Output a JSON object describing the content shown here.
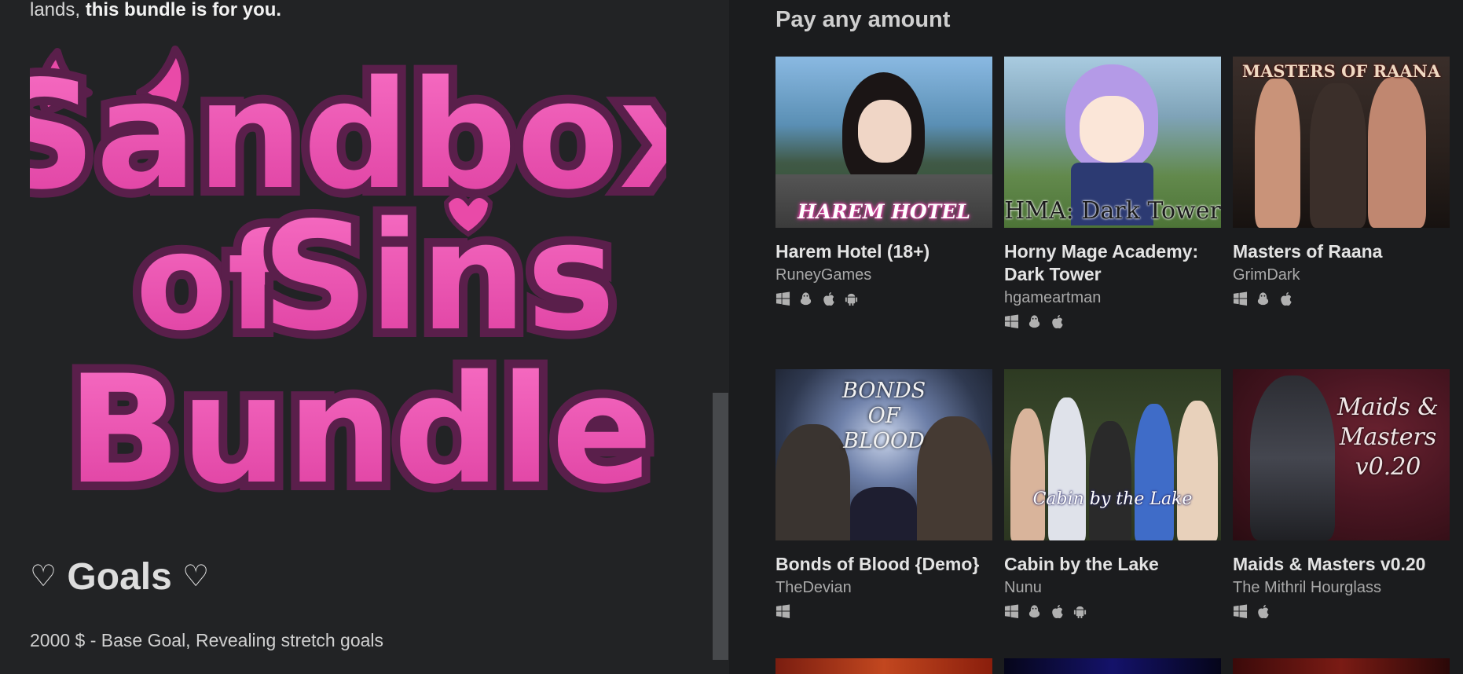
{
  "intro": {
    "prefix": "lands, ",
    "bold": "this bundle is for you."
  },
  "logo": {
    "line1": "Sandbox",
    "line2a": "of",
    "line2b": "Sins",
    "line3": "Bundle"
  },
  "goals": {
    "heart_left": "♡",
    "title": "Goals",
    "heart_right": "♡",
    "line": "2000 $ - Base Goal, Revealing stretch goals"
  },
  "section": {
    "title": "Pay any amount"
  },
  "games": [
    {
      "title": "Harem Hotel (18+)",
      "author": "RuneyGames",
      "cover_text": "HAREM HOTEL",
      "platforms": [
        "windows-icon",
        "linux-icon",
        "apple-icon",
        "android-icon"
      ]
    },
    {
      "title": "Horny Mage Academy: Dark Tower",
      "author": "hgameartman",
      "cover_text": "HMA: Dark Tower",
      "platforms": [
        "windows-icon",
        "linux-icon",
        "apple-icon"
      ]
    },
    {
      "title": "Masters of Raana",
      "author": "GrimDark",
      "cover_text": "MASTERS OF RAANA",
      "platforms": [
        "windows-icon",
        "linux-icon",
        "apple-icon"
      ]
    },
    {
      "title": "Bonds of Blood {Demo}",
      "author": "TheDevian",
      "cover_text": "BONDS OF BLOOD",
      "platforms": [
        "windows-icon"
      ]
    },
    {
      "title": "Cabin by the Lake",
      "author": "Nunu",
      "cover_text": "Cabin by the Lake",
      "platforms": [
        "windows-icon",
        "linux-icon",
        "apple-icon",
        "android-icon"
      ]
    },
    {
      "title": "Maids & Masters v0.20",
      "author": "The Mithril Hourglass",
      "cover_text": "Maids & Masters v0.20",
      "platforms": [
        "windows-icon",
        "apple-icon"
      ]
    }
  ],
  "colors": {
    "accent_pink": "#e94aa8",
    "outline_purple": "#5a1f4b",
    "background": "#222325"
  }
}
